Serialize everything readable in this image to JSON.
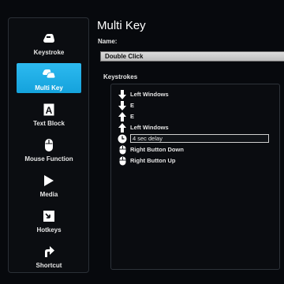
{
  "sidebar": {
    "items": [
      {
        "label": "Keystroke",
        "icon": "keyboard-key-icon"
      },
      {
        "label": "Multi Key",
        "icon": "multi-key-icon",
        "active": true
      },
      {
        "label": "Text Block",
        "icon": "text-block-icon"
      },
      {
        "label": "Mouse Function",
        "icon": "mouse-icon"
      },
      {
        "label": "Media",
        "icon": "play-icon"
      },
      {
        "label": "Hotkeys",
        "icon": "hotkey-icon"
      },
      {
        "label": "Shortcut",
        "icon": "shortcut-arrow-icon"
      }
    ]
  },
  "main": {
    "title": "Multi Key",
    "name_label": "Name:",
    "name_value": "Double Click",
    "keystrokes_label": "Keystrokes",
    "keystrokes": [
      {
        "icon": "arrow-down-icon",
        "text": "Left Windows"
      },
      {
        "icon": "arrow-down-icon",
        "text": "E"
      },
      {
        "icon": "arrow-up-icon",
        "text": "E"
      },
      {
        "icon": "arrow-up-icon",
        "text": "Left Windows"
      },
      {
        "icon": "clock-icon",
        "text": "4 sec delay"
      },
      {
        "icon": "mouse-button-icon",
        "text": "Right Button Down"
      },
      {
        "icon": "mouse-button-icon",
        "text": "Right Button Up"
      }
    ]
  },
  "colors": {
    "accent": "#1fb0e8",
    "background": "#07090d"
  }
}
